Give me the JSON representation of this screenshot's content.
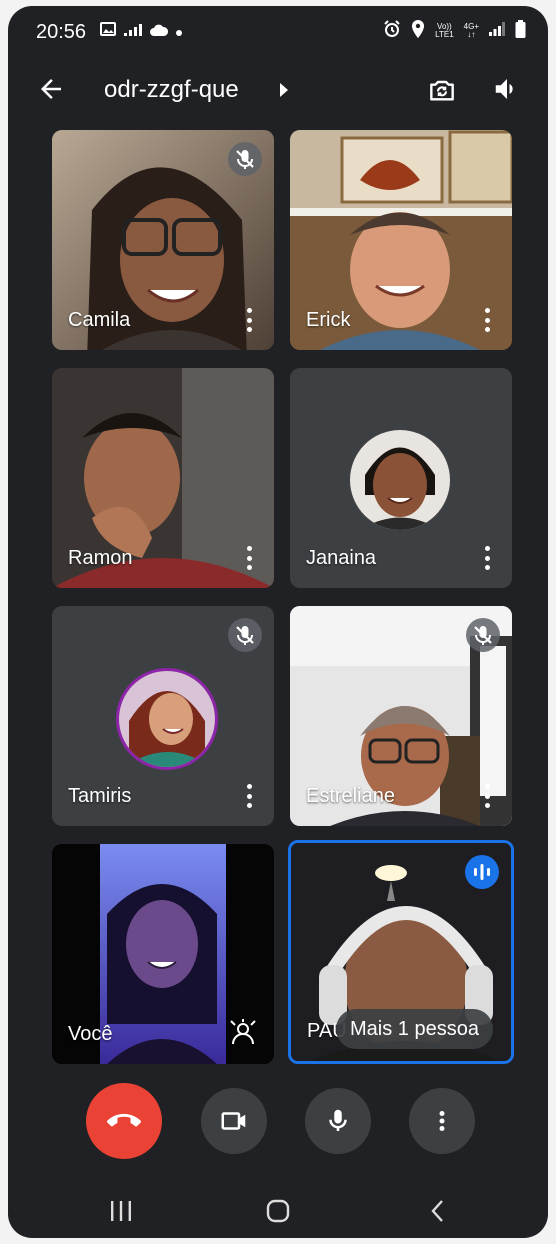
{
  "status_bar": {
    "time": "20:56",
    "network_label_top": "Vo))",
    "network_label_bottom": "LTE1",
    "data_label_top": "4G+",
    "data_label_bottom": "↓↑"
  },
  "top_bar": {
    "meeting_code": "odr-zzgf-que"
  },
  "participants": [
    {
      "name": "Camila"
    },
    {
      "name": "Erick"
    },
    {
      "name": "Ramon"
    },
    {
      "name": "Janaina"
    },
    {
      "name": "Tamiris"
    },
    {
      "name": "Estreliane"
    },
    {
      "name": "Você"
    },
    {
      "name": "PAU"
    }
  ],
  "overflow_pill": "Mais 1 pessoa",
  "colors": {
    "background": "#202124",
    "tile": "#3c4043",
    "end_call": "#ea4335",
    "active_speaker": "#1a73e8"
  }
}
